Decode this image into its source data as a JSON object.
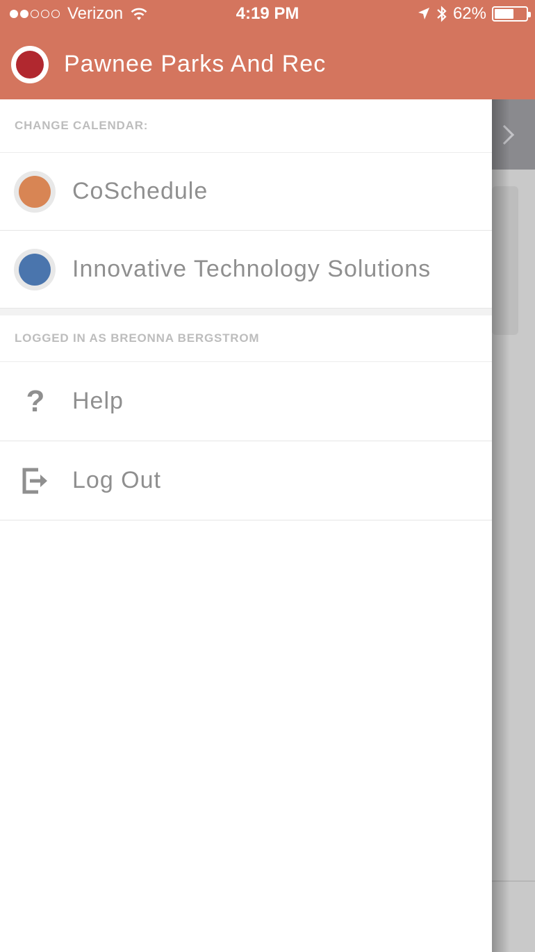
{
  "status_bar": {
    "signal_dots_filled": 2,
    "signal_dots_total": 5,
    "carrier": "Verizon",
    "time": "4:19 PM",
    "battery_percent": "62%",
    "battery_level": 0.62
  },
  "header": {
    "title": "Pawnee Parks And Rec",
    "badge_color": "#b1282f",
    "background_color": "#d4755e"
  },
  "calendars_section": {
    "header": "CHANGE CALENDAR:",
    "items": [
      {
        "label": "CoSchedule",
        "color": "#d88554"
      },
      {
        "label": "Innovative Technology Solutions",
        "color": "#4a75ad"
      }
    ]
  },
  "account_section": {
    "header": "LOGGED IN AS BREONNA BERGSTROM",
    "items": [
      {
        "label": "Help",
        "icon": "question-mark-icon"
      },
      {
        "label": "Log Out",
        "icon": "logout-icon"
      }
    ]
  },
  "background": {
    "add_icon": "plus-icon",
    "nav_icon": "chevron-right-icon"
  }
}
